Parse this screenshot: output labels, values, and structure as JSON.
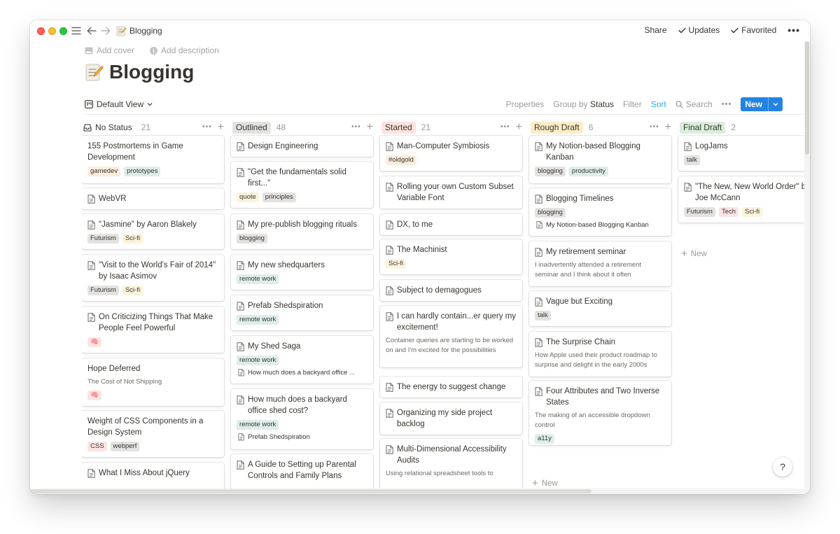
{
  "window": {
    "breadcrumb": "Blogging",
    "top_actions": {
      "share": "Share",
      "updates": "Updates",
      "favorited": "Favorited"
    }
  },
  "page": {
    "add_cover": "Add cover",
    "add_description": "Add description",
    "title": "Blogging"
  },
  "viewbar": {
    "view_name": "Default View",
    "properties": "Properties",
    "group_by_prefix": "Group by",
    "group_by_value": "Status",
    "filter": "Filter",
    "sort": "Sort",
    "search": "Search",
    "new": "New"
  },
  "colors": {
    "accent": "#2383e2",
    "sort_link": "#2eaadc",
    "tag_orange": "#fbecdd",
    "tag_green": "#ddedea",
    "tag_gray": "#e3e2e0",
    "tag_yellow": "#fbf3db",
    "tag_red": "#fbe4e4",
    "tag_brown": "#e9e5e3",
    "tag_purple": "#eae4f2",
    "status_red": "#ffe2dd",
    "status_yellow": "#fdecc8",
    "status_green": "#dbeddb"
  },
  "board": {
    "new_label": "New",
    "columns": [
      {
        "name": "No Status",
        "count": "21",
        "cards": [
          {
            "title": "155 Postmortems in Game Development",
            "icon": false,
            "tags": [
              {
                "label": "gamedev",
                "color": "#fbecdd"
              },
              {
                "label": "prototypes",
                "color": "#ddedea"
              }
            ]
          },
          {
            "title": "WebVR",
            "icon": true,
            "tags": []
          },
          {
            "title": "\"Jasmine\" by Aaron Blakely",
            "icon": true,
            "tags": [
              {
                "label": "Futurism",
                "color": "#e3e2e0"
              },
              {
                "label": "Sci-fi",
                "color": "#fbf3db"
              }
            ]
          },
          {
            "title": "\"Visit to the World's Fair of 2014\" by Isaac Asimov",
            "icon": true,
            "tags": [
              {
                "label": "Futurism",
                "color": "#e3e2e0"
              },
              {
                "label": "Sci-fi",
                "color": "#fbf3db"
              }
            ]
          },
          {
            "title": "On Criticizing Things That Make People Feel Powerful",
            "icon": true,
            "tags": [
              {
                "label": "🧠",
                "color": "#fbe4e4"
              }
            ]
          },
          {
            "title": "Hope Deferred",
            "icon": false,
            "desc": "The Cost of Not Shipping",
            "tags": [
              {
                "label": "🧠",
                "color": "#fbe4e4"
              }
            ]
          },
          {
            "title": "Weight of CSS Components in a Design System",
            "icon": false,
            "tags": [
              {
                "label": "CSS",
                "color": "#fbe4e4"
              },
              {
                "label": "webperf",
                "color": "#e3e2e0"
              }
            ]
          },
          {
            "title": "What I Miss About jQuery",
            "icon": true,
            "tags": []
          }
        ]
      },
      {
        "name": "Outlined",
        "count": "48",
        "pill": "#e3e2e0",
        "cards": [
          {
            "title": "Design Engineering",
            "icon": true,
            "tags": []
          },
          {
            "title": "\"Get the fundamentals solid first...\"",
            "icon": true,
            "tags": [
              {
                "label": "quote",
                "color": "#fbf3db"
              },
              {
                "label": "principles",
                "color": "#e3e2e0"
              }
            ]
          },
          {
            "title": "My pre-publish blogging rituals",
            "icon": true,
            "tags": [
              {
                "label": "blogging",
                "color": "#e3e2e0"
              }
            ]
          },
          {
            "title": "My new shedquarters",
            "icon": true,
            "tags": [
              {
                "label": "remote work",
                "color": "#ddedea"
              }
            ]
          },
          {
            "title": "Prefab Shedspiration",
            "icon": true,
            "tags": [
              {
                "label": "remote work",
                "color": "#ddedea"
              }
            ]
          },
          {
            "title": "My Shed Saga",
            "icon": true,
            "tags": [
              {
                "label": "remote work",
                "color": "#ddedea"
              }
            ],
            "rel": "How much does a backyard office ..."
          },
          {
            "title": "How much does a backyard office shed cost?",
            "icon": true,
            "tags": [
              {
                "label": "remote work",
                "color": "#ddedea"
              }
            ],
            "rel": "Prefab Shedspiration"
          },
          {
            "title": "A Guide to Setting up Parental Controls and Family Plans",
            "icon": true,
            "tags": []
          }
        ]
      },
      {
        "name": "Started",
        "count": "21",
        "pill": "#ffe2dd",
        "cards": [
          {
            "title": "Man-Computer Symbiosis",
            "icon": true,
            "tags": [
              {
                "label": "#oldgold",
                "color": "#fbecdd"
              }
            ]
          },
          {
            "title": "Rolling your own Custom Subset Variable Font",
            "icon": true,
            "tags": []
          },
          {
            "title": "DX, to me",
            "icon": true,
            "tags": []
          },
          {
            "title": "The Machinist",
            "icon": true,
            "tags": [
              {
                "label": "Sci-fi",
                "color": "#fbf3db"
              }
            ]
          },
          {
            "title": "Subject to demagogues",
            "icon": true,
            "tags": []
          },
          {
            "title": "I can hardly contain...er query my excitement!",
            "icon": true,
            "desc": "Container queries are starting to be worked on and I'm excited for the possibilities",
            "tags": []
          },
          {
            "title": "The energy to suggest change",
            "icon": true,
            "tags": []
          },
          {
            "title": "Organizing my side project backlog",
            "icon": true,
            "tags": []
          },
          {
            "title": "Multi-Dimensional Accessibility Audits",
            "icon": true,
            "desc": "Using relational spreadsheet tools to",
            "tags": []
          }
        ]
      },
      {
        "name": "Rough Draft",
        "count": "6",
        "pill": "#fdecc8",
        "cards": [
          {
            "title": "My Notion-based Blogging Kanban",
            "icon": true,
            "tags": [
              {
                "label": "blogging",
                "color": "#e3e2e0"
              },
              {
                "label": "productivity",
                "color": "#ddedea"
              }
            ]
          },
          {
            "title": "Blogging Timelines",
            "icon": true,
            "tags": [
              {
                "label": "blogging",
                "color": "#e3e2e0"
              }
            ],
            "rel": "My Notion-based Blogging Kanban"
          },
          {
            "title": "My retirement seminar",
            "icon": true,
            "desc": "I inadvertently attended a retirement seminar and I think about it often",
            "tags": []
          },
          {
            "title": "Vague but Exciting",
            "icon": true,
            "tags": [
              {
                "label": "talk",
                "color": "#e3e2e0"
              }
            ]
          },
          {
            "title": "The Surprise Chain",
            "icon": true,
            "desc": "How Apple used their product roadmap to surprise and delight in the early 2000s",
            "tags": []
          },
          {
            "title": "Four Attributes and Two Inverse States",
            "icon": true,
            "desc": "The making of an accessible dropdown control",
            "tags": [
              {
                "label": "a11y",
                "color": "#ddedea"
              }
            ]
          }
        ]
      },
      {
        "name": "Final Draft",
        "count": "2",
        "pill": "#dbeddb",
        "cards": [
          {
            "title": "LogJams",
            "icon": true,
            "tags": [
              {
                "label": "talk",
                "color": "#e3e2e0"
              }
            ]
          },
          {
            "title": "\"The New, New World Order\" by Joe McCann",
            "icon": true,
            "tags": [
              {
                "label": "Futurism",
                "color": "#e3e2e0"
              },
              {
                "label": "Tech",
                "color": "#fbe4e4"
              },
              {
                "label": "Sci-fi",
                "color": "#fbf3db"
              }
            ]
          }
        ]
      }
    ]
  },
  "help_label": "?"
}
